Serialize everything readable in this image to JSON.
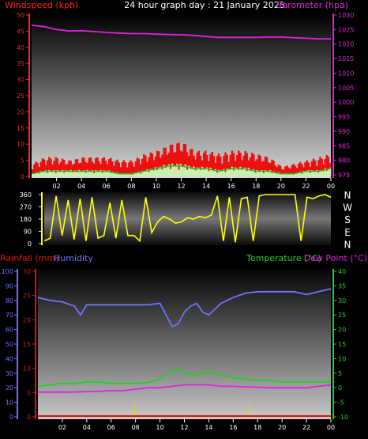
{
  "title": "24 hour graph day : 21 January 2025",
  "colors": {
    "wind_label": "#ff2020",
    "baro": "#e020e0",
    "rain": "#e01010",
    "humidity": "#7070ff",
    "temperature": "#20d020",
    "dewpoint": "#e020e0",
    "winddir": "#ffff00",
    "text_white": "#ffffff"
  },
  "x_ticks": [
    "02",
    "04",
    "06",
    "08",
    "10",
    "12",
    "14",
    "16",
    "18",
    "20",
    "22",
    "00"
  ],
  "chart_data": [
    {
      "type": "area",
      "name": "wind-barometer",
      "left_label": "Windspeed (kph)",
      "right_label": "Barometer (hpa)",
      "left_ticks": [
        0,
        5,
        10,
        15,
        20,
        25,
        30,
        35,
        40,
        45,
        50
      ],
      "right_ticks": [
        975,
        980,
        985,
        990,
        995,
        1000,
        1005,
        1010,
        1015,
        1020,
        1025,
        1030
      ],
      "ylim_left": [
        0,
        50
      ],
      "ylim_right": [
        975,
        1030
      ],
      "series": [
        {
          "name": "Barometer (hpa)",
          "x_hours": [
            0,
            1,
            2,
            3,
            4,
            5,
            6,
            7,
            8,
            9,
            10,
            11,
            12,
            13,
            14,
            15,
            16,
            17,
            18,
            19,
            20,
            21,
            22,
            23,
            24
          ],
          "values": [
            1026.5,
            1026,
            1025,
            1024.5,
            1024.6,
            1024.3,
            1024.0,
            1023.8,
            1023.6,
            1023.6,
            1023.4,
            1023.3,
            1023.2,
            1023.0,
            1022.6,
            1022.3,
            1022.3,
            1022.3,
            1022.3,
            1022.4,
            1022.4,
            1022.2,
            1022.0,
            1021.8,
            1021.8
          ]
        },
        {
          "name": "Wind gust",
          "x_hours": [
            0,
            1,
            2,
            3,
            4,
            5,
            6,
            7,
            8,
            9,
            10,
            11,
            12,
            13,
            14,
            15,
            16,
            17,
            18,
            19,
            20,
            21,
            22,
            23,
            24
          ],
          "values": [
            4,
            6,
            6,
            5,
            6,
            6,
            6,
            5,
            5,
            7,
            8,
            10,
            11,
            8,
            8,
            7,
            8,
            8,
            7,
            6,
            3,
            4,
            5,
            6,
            7
          ]
        },
        {
          "name": "Wind speed",
          "x_hours": [
            0,
            1,
            2,
            3,
            4,
            5,
            6,
            7,
            8,
            9,
            10,
            11,
            12,
            13,
            14,
            15,
            16,
            17,
            18,
            19,
            20,
            21,
            22,
            23,
            24
          ],
          "values": [
            1,
            2,
            2,
            2,
            2,
            2,
            2,
            1,
            1,
            2,
            3,
            4,
            4,
            3,
            3,
            2,
            3,
            3,
            2,
            2,
            1,
            1,
            2,
            2,
            3
          ]
        }
      ]
    },
    {
      "type": "line",
      "name": "wind-direction",
      "left_ticks": [
        0,
        90,
        180,
        270,
        360
      ],
      "ylim": [
        0,
        360
      ],
      "compass": [
        "N",
        "W",
        "S",
        "E",
        "N"
      ],
      "series": [
        {
          "name": "Wind direction",
          "x_hours": [
            0,
            0.5,
            1,
            1.5,
            2,
            2.5,
            3,
            3.5,
            4,
            4.5,
            5,
            5.5,
            6,
            6.5,
            7,
            7.5,
            8,
            8.5,
            9,
            9.5,
            10,
            10.5,
            11,
            11.5,
            12,
            12.5,
            13,
            13.5,
            14,
            14.5,
            15,
            15.5,
            16,
            16.5,
            17,
            17.5,
            18,
            18.5,
            19,
            19.5,
            20,
            20.5,
            21,
            21.5,
            22,
            22.5,
            23,
            23.5,
            24
          ],
          "values": [
            20,
            40,
            350,
            60,
            320,
            30,
            330,
            20,
            340,
            40,
            60,
            300,
            40,
            320,
            60,
            60,
            20,
            340,
            80,
            160,
            200,
            180,
            150,
            160,
            190,
            180,
            200,
            190,
            210,
            350,
            20,
            340,
            10,
            330,
            340,
            20,
            350,
            360,
            360,
            360,
            360,
            360,
            360,
            20,
            340,
            330,
            350,
            360,
            340
          ]
        }
      ]
    },
    {
      "type": "line",
      "name": "rain-humidity-temperature",
      "left_label_rain": "Rainfall (mm)",
      "left_label_hum": "Humidity",
      "right_label_temp": "Temperature (°C)",
      "right_label_dew": "Dew Point (°C)",
      "humidity_ticks": [
        0,
        10,
        20,
        30,
        40,
        50,
        60,
        70,
        80,
        90,
        100
      ],
      "rain_ticks": [
        0,
        5,
        10,
        15,
        20,
        25,
        30
      ],
      "temp_ticks": [
        -10,
        -5,
        0,
        5,
        10,
        15,
        20,
        25,
        30,
        35,
        40
      ],
      "ylim_rain": [
        0,
        30
      ],
      "ylim_temp": [
        -10,
        40
      ],
      "series": [
        {
          "name": "Humidity",
          "x_hours": [
            0,
            1,
            2,
            3,
            3.5,
            4,
            5,
            6,
            7,
            8,
            9,
            10,
            10.5,
            11,
            11.5,
            12,
            12.5,
            13,
            13.5,
            14,
            15,
            16,
            17,
            18,
            19,
            20,
            21,
            22,
            23,
            24
          ],
          "values": [
            82,
            80,
            79,
            76,
            70,
            77,
            77,
            77,
            77,
            77,
            77,
            78,
            70,
            62,
            64,
            72,
            76,
            78,
            72,
            70,
            78,
            82,
            85,
            86,
            86,
            86,
            86,
            84,
            86,
            88
          ]
        },
        {
          "name": "Temperature (°C)",
          "x_hours": [
            0,
            1,
            2,
            3,
            4,
            5,
            6,
            7,
            8,
            9,
            10,
            11,
            11.5,
            12,
            12.5,
            13,
            14,
            15,
            16,
            17,
            18,
            19,
            20,
            21,
            22,
            23,
            24
          ],
          "values": [
            0.5,
            1,
            1.5,
            1.5,
            2,
            2,
            1.5,
            1.5,
            1.5,
            1.8,
            3,
            5.5,
            6.5,
            5,
            4.5,
            4.5,
            5.5,
            4.5,
            3.5,
            3,
            2.5,
            2.5,
            2,
            2,
            2,
            2,
            2
          ]
        },
        {
          "name": "Dew Point (°C)",
          "x_hours": [
            0,
            1,
            2,
            3,
            4,
            5,
            6,
            7,
            8,
            9,
            10,
            11,
            12,
            13,
            14,
            15,
            16,
            17,
            18,
            19,
            20,
            21,
            22,
            23,
            24
          ],
          "values": [
            -1.5,
            -1.5,
            -1.5,
            -1.5,
            -1.3,
            -1.2,
            -1,
            -1,
            -0.5,
            0,
            0,
            0.5,
            1,
            1,
            1,
            0.5,
            0.5,
            0.3,
            0.2,
            0,
            0,
            0,
            0,
            0.5,
            1
          ]
        },
        {
          "name": "Rainfall (mm)",
          "x_hours": [
            7.9,
            17.3
          ],
          "values": [
            0.3,
            0.3
          ]
        }
      ]
    }
  ]
}
